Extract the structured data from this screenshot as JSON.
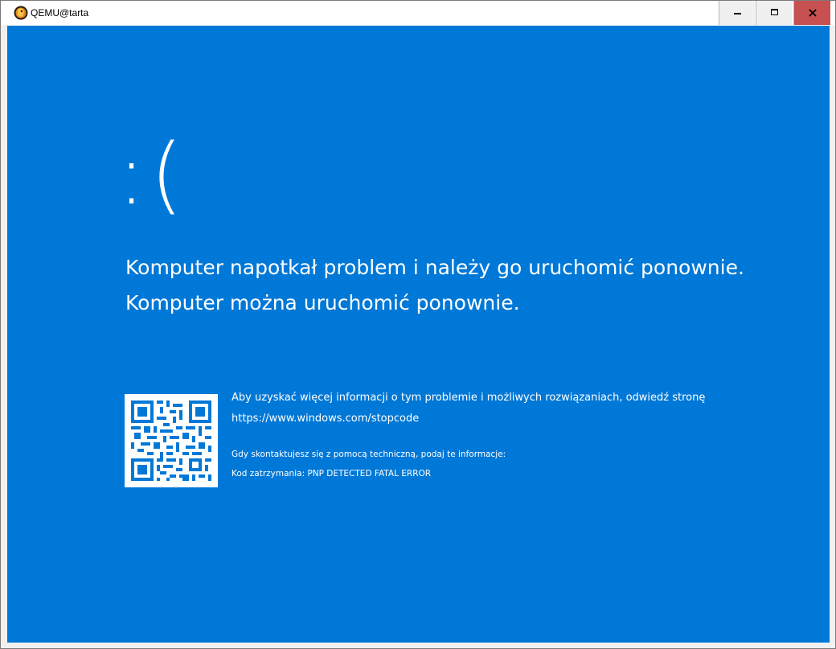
{
  "window": {
    "title": "QEMU@tarta"
  },
  "bsod": {
    "face": ":(",
    "message_line1": "Komputer napotkał problem i należy go uruchomić ponownie.",
    "message_line2": "Komputer można uruchomić ponownie.",
    "info_text": "Aby uzyskać więcej informacji o tym problemie i możliwych rozwiązaniach, odwiedź stronę",
    "url": "https://www.windows.com/stopcode",
    "contact_text": "Gdy skontaktujesz się z pomocą techniczną, podaj te informacje:",
    "stop_code": "Kod zatrzymania: PNP DETECTED FATAL ERROR"
  },
  "colors": {
    "background": "#0078d7",
    "text": "#ffffff",
    "close_button": "#c75050"
  },
  "icons": {
    "app": "qemu-icon",
    "minimize": "minimize-icon",
    "maximize": "maximize-icon",
    "close": "close-icon",
    "qr": "qr-code"
  }
}
